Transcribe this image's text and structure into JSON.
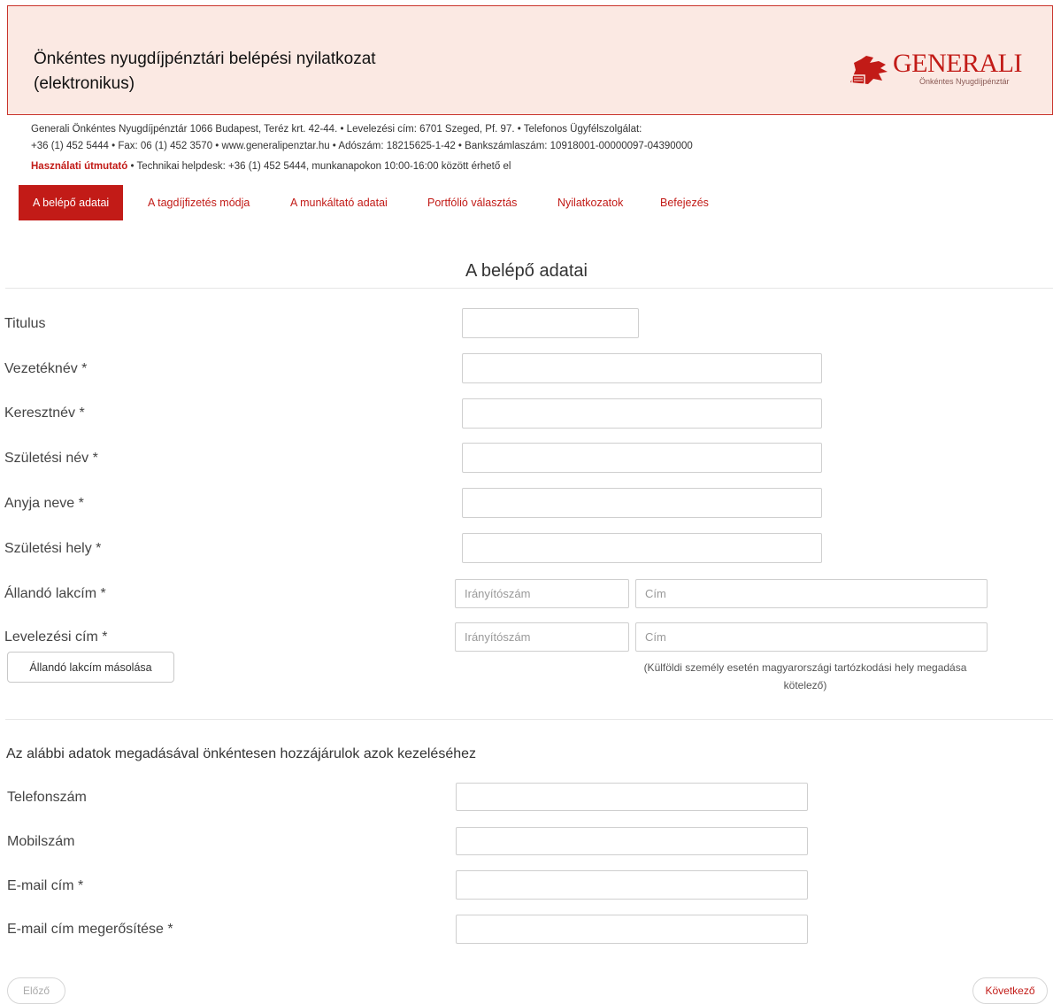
{
  "header": {
    "title": "Önkéntes nyugdíjpénztári belépési nyilatkozat (elektronikus)",
    "logo_word": "GENERALI",
    "logo_sub": "Önkéntes Nyugdíjpénztár"
  },
  "info": {
    "line1": "Generali Önkéntes Nyugdíjpénztár 1066 Budapest, Teréz krt. 42-44. • Levelezési cím: 6701 Szeged, Pf. 97. • Telefonos Ügyfélszolgálat:",
    "line2": "+36 (1) 452 5444 • Fax: 06 (1) 452 3570 • www.generalipenztar.hu • Adószám: 18215625-1-42 • Bankszámlaszám: 10918001-00000097-04390000",
    "guide_link": "Használati útmutató",
    "helpdesk": " • Technikai helpdesk: +36 (1) 452 5444, munkanapokon 10:00-16:00 között érhető el"
  },
  "tabs": [
    {
      "label": "A belépő adatai"
    },
    {
      "label": "A tagdíjfizetés módja"
    },
    {
      "label": "A munkáltató adatai"
    },
    {
      "label": "Portfólió választás"
    },
    {
      "label": "Nyilatkozatok"
    },
    {
      "label": "Befejezés"
    }
  ],
  "section_title": "A belépő adatai",
  "form": {
    "titulus": "Titulus",
    "vezeteknev": "Vezetéknév *",
    "keresztnev": "Keresztnév *",
    "szuletesi_nev": "Születési név *",
    "anyja_neve": "Anyja neve *",
    "szuletesi_hely": "Születési hely *",
    "allando_lakcim": "Állandó lakcím *",
    "levelezesi_cim": "Levelezési cím *",
    "zip_placeholder": "Irányítószám",
    "address_placeholder": "Cím",
    "copy_button": "Állandó lakcím másolása",
    "foreign_note": "(Külföldi személy esetén magyarországi tartózkodási hely megadása kötelező)"
  },
  "consent": {
    "text": "Az alábbi adatok megadásával önkéntesen hozzájárulok azok kezeléséhez",
    "telefon": "Telefonszám",
    "mobil": "Mobilszám",
    "email": "E-mail cím *",
    "email_confirm": "E-mail cím megerősítése *"
  },
  "nav": {
    "prev": "Előző",
    "next": "Következő"
  },
  "colors": {
    "brand": "#c21b17",
    "header_bg": "#fbe9e3"
  }
}
